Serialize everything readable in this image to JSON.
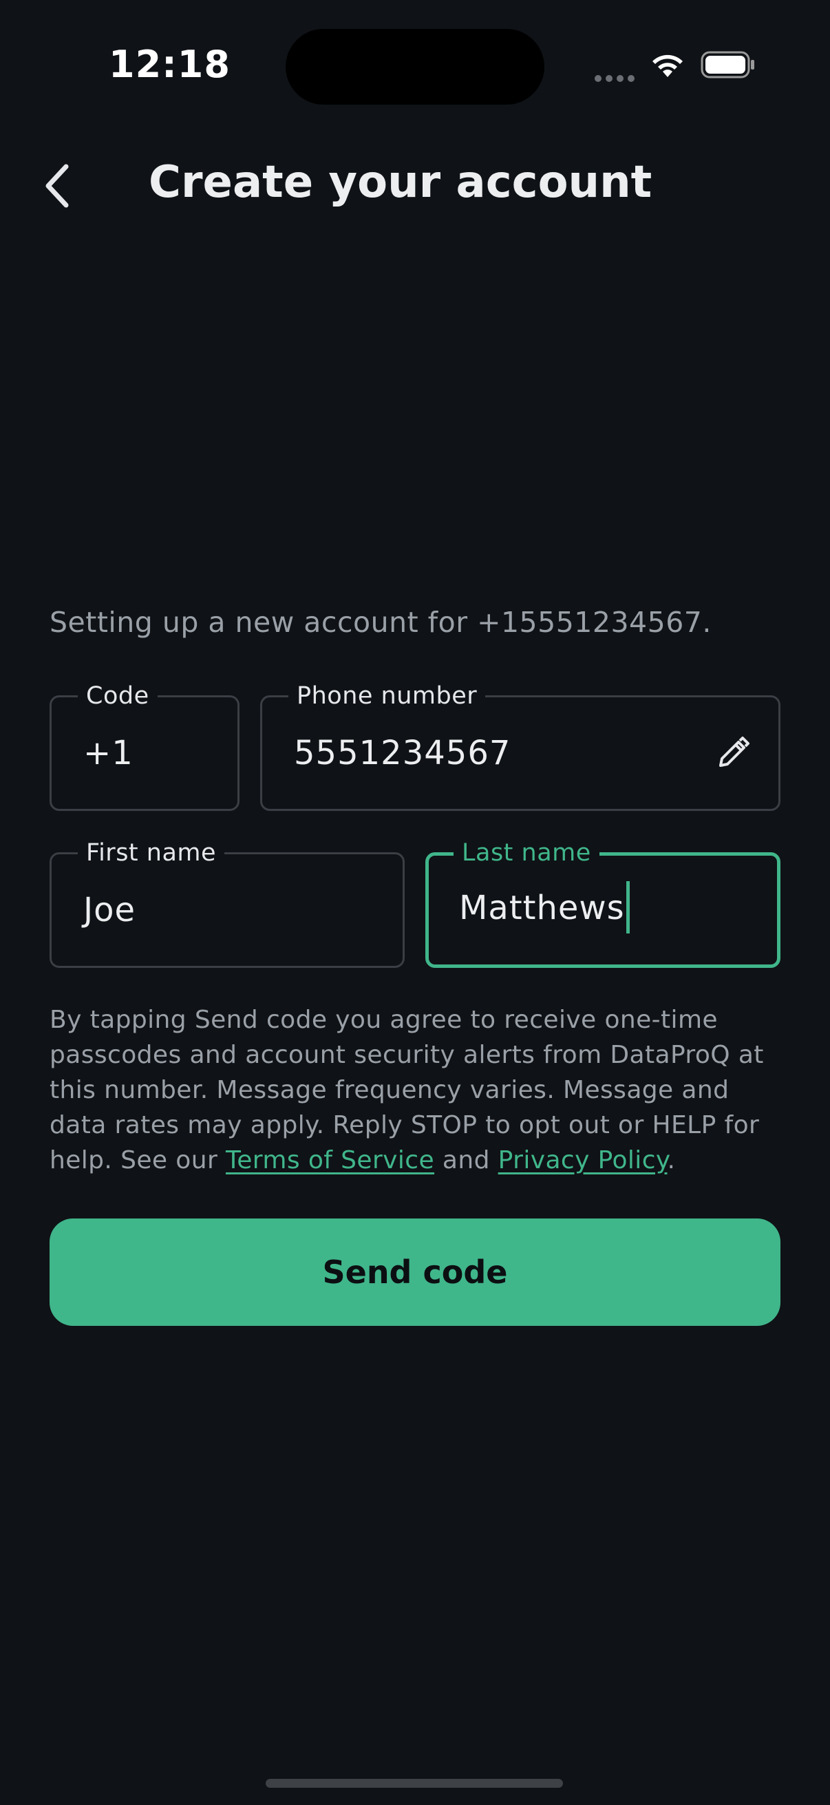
{
  "status_bar": {
    "time": "12:18",
    "icons": [
      "cellular-signal-icon",
      "wifi-icon",
      "battery-icon"
    ]
  },
  "header": {
    "back_icon": "chevron-left-icon",
    "title": "Create your account"
  },
  "intro": "Setting up a new account for +15551234567.",
  "form": {
    "code": {
      "label": "Code",
      "value": "+1"
    },
    "phone": {
      "label": "Phone number",
      "value": "5551234567",
      "edit_icon": "pencil-icon"
    },
    "first_name": {
      "label": "First name",
      "value": "Joe"
    },
    "last_name": {
      "label": "Last name",
      "value": "Matthews"
    }
  },
  "consent": {
    "text_before": "By tapping Send code you agree to receive one-time passcodes and account security alerts from DataProQ at this number. Message frequency varies. Message and data rates may apply. Reply STOP to opt out or HELP for help. See our ",
    "terms_link": "Terms of Service",
    "and": " and ",
    "privacy_link": "Privacy Policy",
    "text_after": "."
  },
  "send_button": "Send code",
  "colors": {
    "background": "#0f1216",
    "accent": "#40b68b",
    "muted_text": "#9aa0a7",
    "field_border": "#3b3f45"
  }
}
